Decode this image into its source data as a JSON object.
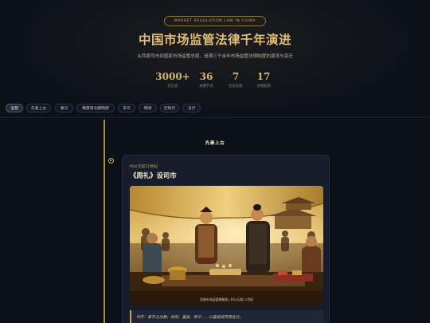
{
  "hero": {
    "eyebrow": "MARKET REGULATION LAW IN CHINA",
    "title": "中国市场监管法律千年演进",
    "subtitle": "从西周司市到国家市场监管总局，追溯三千余年市场监管法律制度的源流与变迁",
    "stats": [
      {
        "value": "3000+",
        "label": "年历史"
      },
      {
        "value": "36",
        "label": "关键节点"
      },
      {
        "value": "7",
        "label": "历史阶段"
      },
      {
        "value": "17",
        "label": "文物配图"
      }
    ]
  },
  "filters": [
    {
      "label": "全部",
      "active": true
    },
    {
      "label": "先秦上古"
    },
    {
      "label": "秦汉"
    },
    {
      "label": "魏晋南北朝隋唐"
    },
    {
      "label": "宋元"
    },
    {
      "label": "明清"
    },
    {
      "label": "近现代"
    },
    {
      "label": "当代"
    }
  ],
  "era": {
    "heading": "先秦上古"
  },
  "event": {
    "date": "约公元前11世纪",
    "title": "《周礼》设司市",
    "image_caption": "西周市场监管想象图 | 约公元前11世纪",
    "quote": "司市：掌市之治教、政刑、量度、禁令……以量度成贾而征价。"
  },
  "colors": {
    "background": "#0c1019",
    "gold_accent": "#d9b56b",
    "card": "#171d2a",
    "timeline": "#b08a3e"
  }
}
